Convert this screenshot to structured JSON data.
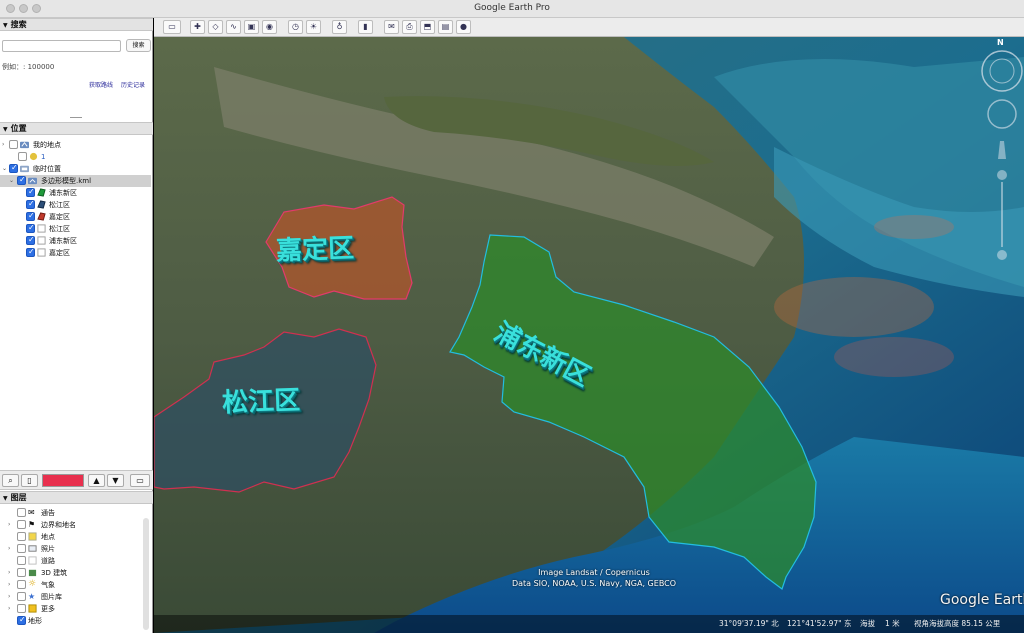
{
  "window": {
    "title": "Google Earth Pro"
  },
  "search": {
    "header": "搜索",
    "button": "搜索",
    "example": "例如：: 100000",
    "links": {
      "directions": "获取路线",
      "history": "历史记录"
    }
  },
  "places": {
    "header": "位置",
    "items": [
      {
        "label": "我的地点",
        "icon": "my-places-icon",
        "checked": false
      },
      {
        "label": "1",
        "icon": "folder-icon",
        "checked": false
      },
      {
        "label": "临时位置",
        "icon": "temporary-places-icon",
        "checked": true
      },
      {
        "label": "多边形模型.kml",
        "icon": "kml-file-icon",
        "checked": true
      },
      {
        "label": "浦东新区",
        "icon": "polygon-icon",
        "color": "#1f9a3a",
        "checked": true
      },
      {
        "label": "松江区",
        "icon": "polygon-icon",
        "color": "#2c4f78",
        "checked": true
      },
      {
        "label": "嘉定区",
        "icon": "polygon-icon",
        "color": "#c0392b",
        "checked": true
      },
      {
        "label": "松江区",
        "icon": "placemark-icon",
        "checked": true
      },
      {
        "label": "浦东新区",
        "icon": "placemark-icon",
        "checked": true
      },
      {
        "label": "嘉定区",
        "icon": "placemark-icon",
        "checked": true
      }
    ]
  },
  "layers": {
    "header": "图层",
    "items": [
      {
        "label": "通告",
        "icon": "envelope-icon",
        "checked": false
      },
      {
        "label": "边界和地名",
        "icon": "flag-icon",
        "checked": false
      },
      {
        "label": "地点",
        "icon": "place-icon",
        "checked": false
      },
      {
        "label": "照片",
        "icon": "photo-icon",
        "checked": false
      },
      {
        "label": "道路",
        "icon": "road-icon",
        "checked": false
      },
      {
        "label": "3D 建筑",
        "icon": "building-icon",
        "checked": false
      },
      {
        "label": "气象",
        "icon": "weather-icon",
        "checked": false
      },
      {
        "label": "图片库",
        "icon": "gallery-icon",
        "checked": false
      },
      {
        "label": "更多",
        "icon": "more-icon",
        "checked": false
      },
      {
        "label": "地形",
        "icon": "terrain-icon",
        "checked": true
      }
    ]
  },
  "map": {
    "labels": {
      "jiading": "嘉定区",
      "songjiang": "松江区",
      "pudong": "浦东新区"
    },
    "attribution": {
      "line1": "Image Landsat / Copernicus",
      "line2": "Data SIO, NOAA, U.S. Navy, NGA, GEBCO"
    },
    "logo": "Google Earth",
    "compass_n": "N"
  },
  "status": {
    "lat": "31°09'37.19\" 北",
    "lon": "121°41'52.97\" 东",
    "elev_label": "海拔",
    "elev_value": "1 米",
    "eye_alt": "视角海拔高度 85.15 公里"
  },
  "colors": {
    "polygon_label": "#39e0dc",
    "selected_swatch": "#e8304e"
  }
}
